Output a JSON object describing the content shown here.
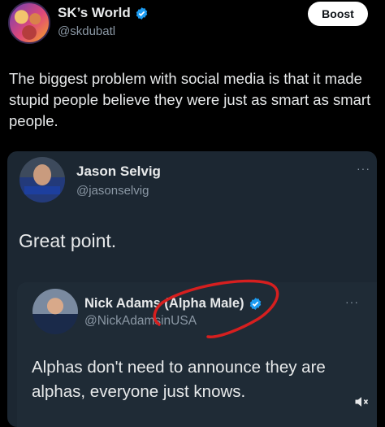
{
  "post": {
    "author_name": "SK’s World",
    "author_handle": "@skdubatl",
    "boost_label": "Boost",
    "text": "The biggest problem with social media is that it made stupid people believe they were just as smart as smart people."
  },
  "quoted_post": {
    "author_name": "Jason Selvig",
    "author_handle": "@jasonselvig",
    "more_label": "···",
    "text": "Great point."
  },
  "nested_quote": {
    "author_name": "Nick Adams (Alpha Male)",
    "author_handle": "@NickAdamsinUSA",
    "more_label": "···",
    "text": "Alphas don't need to announce they are alphas, everyone just knows."
  },
  "colors": {
    "background": "#000000",
    "card": "#1c2732",
    "verified": "#1d9bf0",
    "annotation": "#d61f1f"
  },
  "icons": [
    "verified-badge-icon",
    "more-options-icon",
    "mute-icon"
  ]
}
